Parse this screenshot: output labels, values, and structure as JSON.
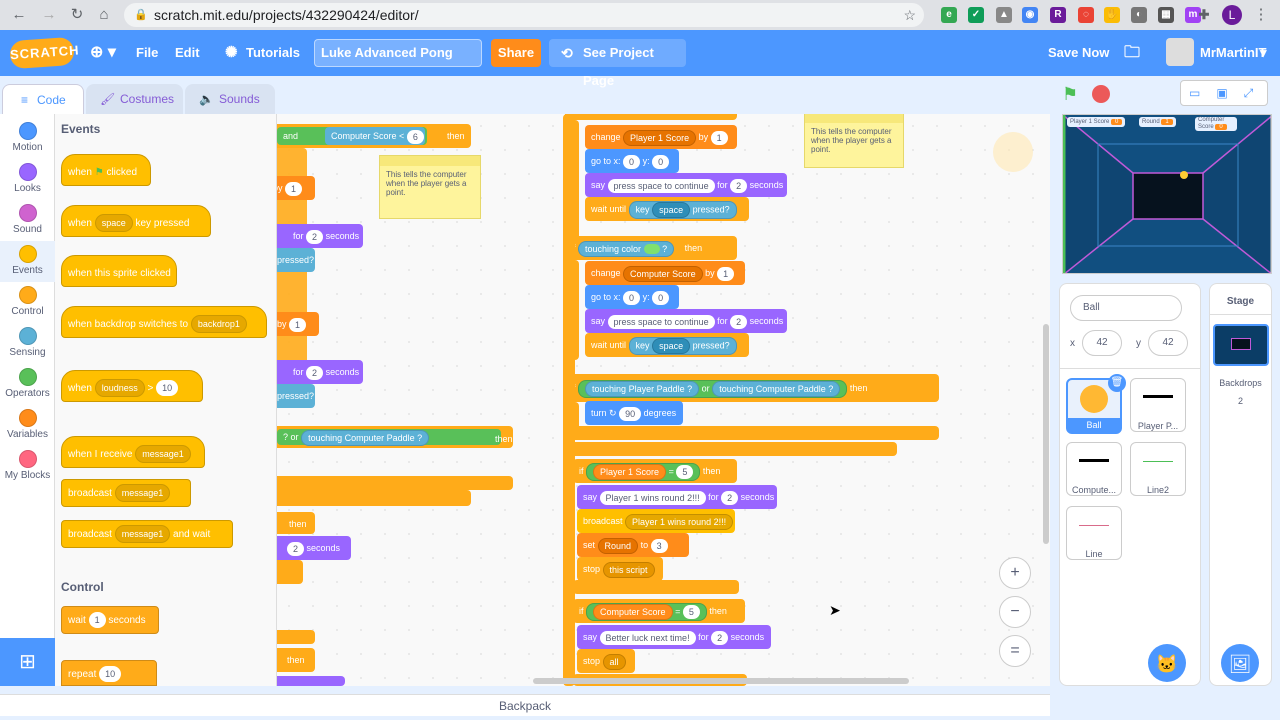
{
  "browser": {
    "url": "scratch.mit.edu/projects/432290424/editor/",
    "profile_initial": "L"
  },
  "menu": {
    "logo": "SCRATCH",
    "file": "File",
    "edit": "Edit",
    "tutorials": "Tutorials",
    "project_title": "Luke Advanced Pong",
    "share": "Share",
    "see_project": "See Project Page",
    "save_now": "Save Now",
    "username": "MrMartinIT"
  },
  "tabs": {
    "code": "Code",
    "costumes": "Costumes",
    "sounds": "Sounds"
  },
  "categories": [
    {
      "label": "Motion",
      "color": "#4c97ff"
    },
    {
      "label": "Looks",
      "color": "#9966ff"
    },
    {
      "label": "Sound",
      "color": "#cf63cf"
    },
    {
      "label": "Events",
      "color": "#ffbf00"
    },
    {
      "label": "Control",
      "color": "#ffab19"
    },
    {
      "label": "Sensing",
      "color": "#5cb1d6"
    },
    {
      "label": "Operators",
      "color": "#59c059"
    },
    {
      "label": "Variables",
      "color": "#ff8c1a"
    },
    {
      "label": "My Blocks",
      "color": "#ff6680"
    }
  ],
  "palette": {
    "events_heading": "Events",
    "control_heading": "Control",
    "when_flag": "when",
    "clicked": "clicked",
    "when": "when",
    "space": "space",
    "key_pressed": "key pressed",
    "sprite_clicked": "when this sprite clicked",
    "backdrop_switch": "when backdrop switches to",
    "backdrop1": "backdrop1",
    "loudness": "loudness",
    "gt": ">",
    "ten": "10",
    "when_receive": "when I receive",
    "message1": "message1",
    "broadcast": "broadcast",
    "and_wait": "and wait",
    "wait": "wait",
    "one": "1",
    "seconds": "seconds",
    "repeat": "repeat"
  },
  "workspace": {
    "if": "if",
    "then": "then",
    "touching_color": "touching color",
    "change": "change",
    "player1_score": "Player 1 Score",
    "computer_score": "Computer Score",
    "by": "by",
    "one": "1",
    "go_to_x": "go to x:",
    "y": "y:",
    "zero": "0",
    "say": "say",
    "press_space": "press space to continue",
    "for": "for",
    "two": "2",
    "seconds": "seconds",
    "wait_until": "wait until",
    "key": "key",
    "space": "space",
    "pressed": "pressed?",
    "touching": "touching",
    "player_paddle": "Player Paddle",
    "computer_paddle": "Computer Paddle",
    "q": "?",
    "or": "or",
    "and": "and",
    "lt": "<",
    "six": "6",
    "turn": "turn",
    "ninety": "90",
    "degrees": "degrees",
    "equals": "=",
    "five": "5",
    "p1_wins": "Player 1 wins round 2!!!",
    "set": "set",
    "round": "Round",
    "to": "to",
    "three": "3",
    "stop": "stop",
    "this_script": "this script",
    "better_luck": "Better luck next time!",
    "all": "all",
    "broadcast": "broadcast",
    "note_text": "This tells the computer when the player gets a point.",
    "zoom_in": "+",
    "zoom_out": "−",
    "zoom_reset": "="
  },
  "stage": {
    "monitor_p1": "Player 1 Score",
    "monitor_p1_val": "0",
    "monitor_round": "Round",
    "monitor_round_val": "1",
    "monitor_comp": "Computer Score",
    "monitor_comp_val": "0"
  },
  "sprite_info": {
    "name": "Ball",
    "x_label": "x",
    "x": "42",
    "y_label": "y",
    "y": "42"
  },
  "sprites": [
    {
      "name": "Ball"
    },
    {
      "name": "Player P..."
    },
    {
      "name": "Compute..."
    },
    {
      "name": "Line2"
    },
    {
      "name": "Line"
    }
  ],
  "stage_pane": {
    "title": "Stage",
    "backdrops_label": "Backdrops",
    "backdrops_count": "2"
  },
  "backpack": "Backpack"
}
